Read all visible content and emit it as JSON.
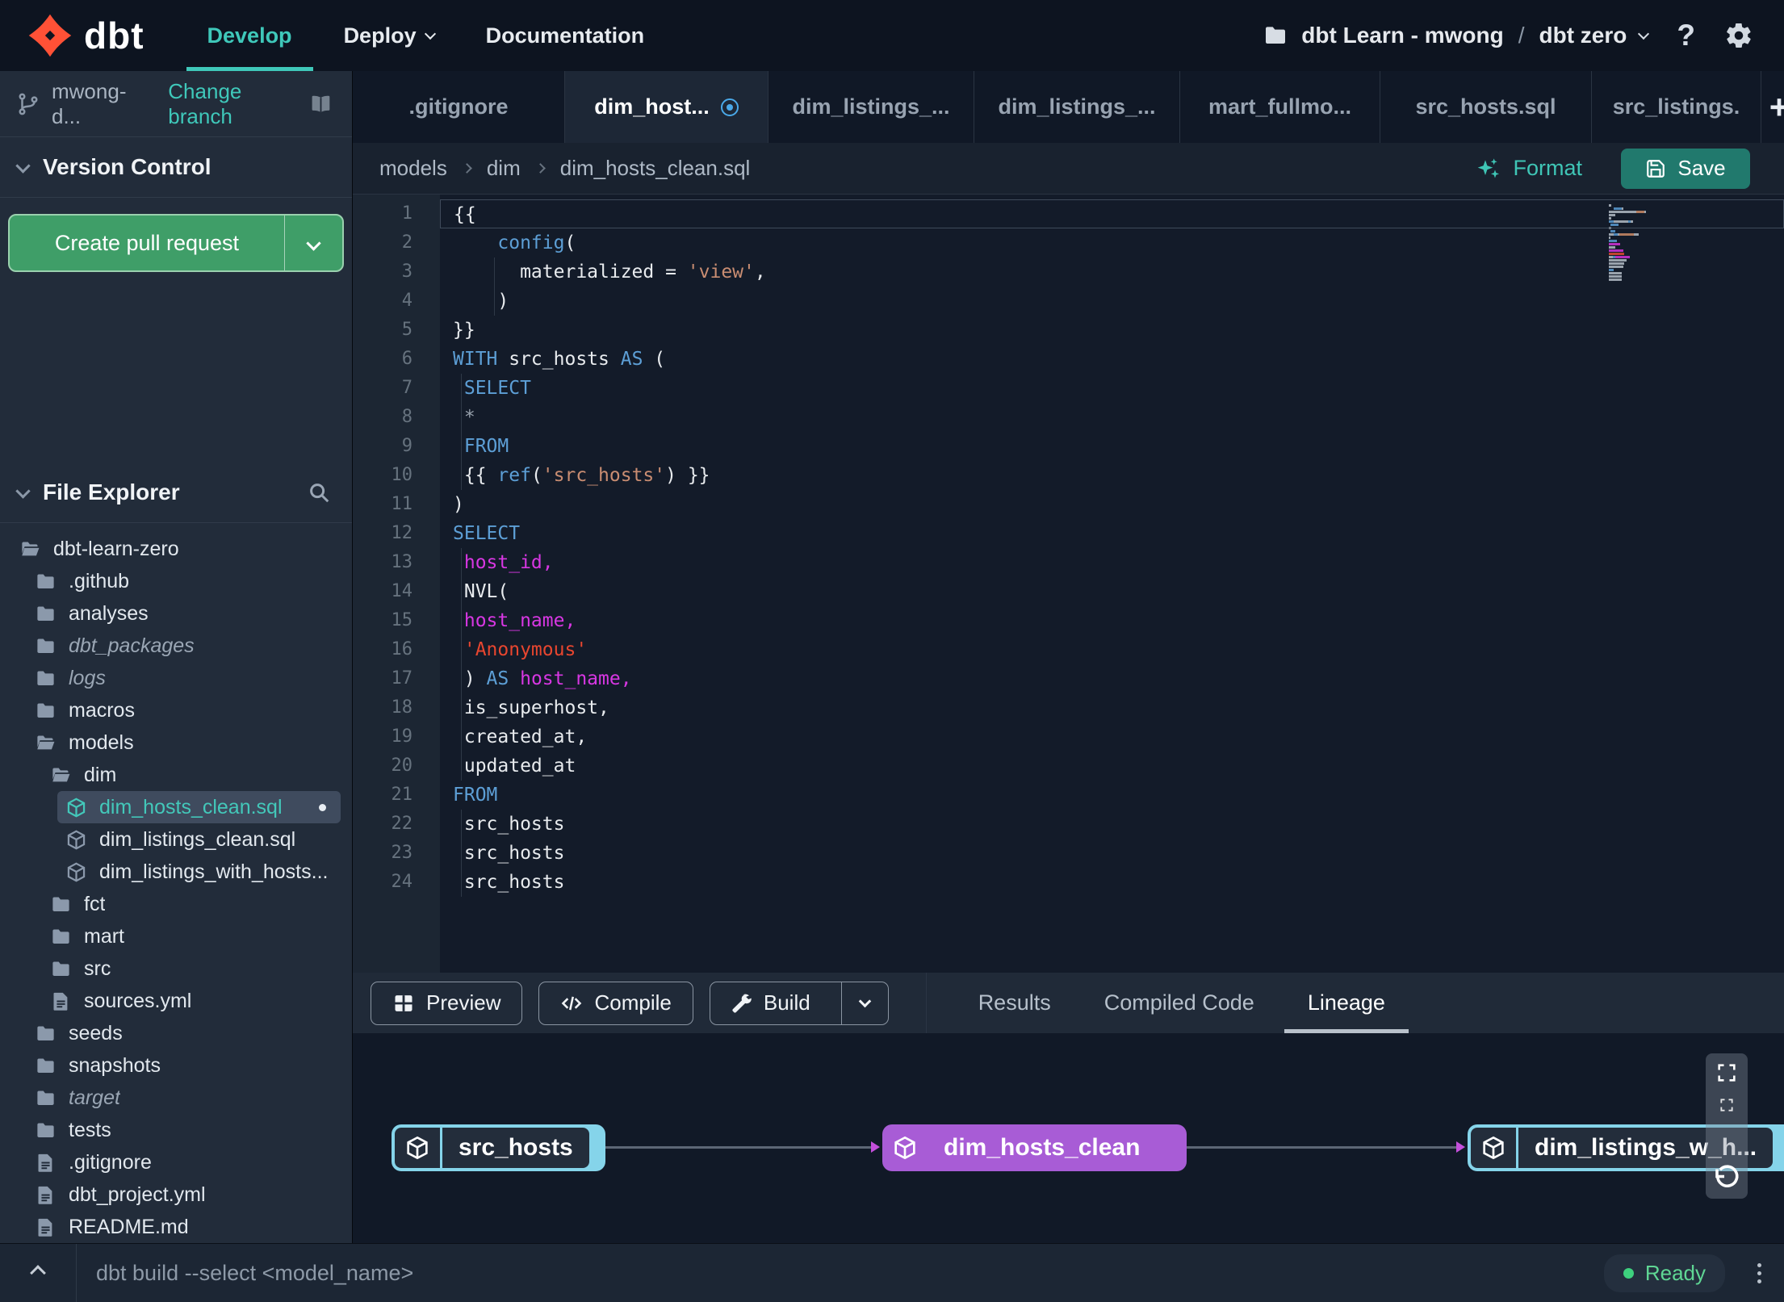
{
  "colors": {
    "accent_teal": "#3fc8ba",
    "brand_orange": "#ff5136",
    "pr_button_green": "#3f9e68",
    "save_button_teal": "#21796d",
    "tab_modified_blue": "#4aa9e9",
    "lineage_purple": "#a85cd6",
    "lineage_cyan": "#85d4ea",
    "status_ready_green": "#3ed17e",
    "syntax_keyword": "#5d9fd6",
    "syntax_jinja_string": "#c98d72",
    "syntax_sql_string": "#e8462f",
    "syntax_identifier": "#d837e3"
  },
  "topnav": {
    "logo_text": "dbt",
    "items": [
      {
        "label": "Develop",
        "active": true,
        "caret": false
      },
      {
        "label": "Deploy",
        "active": false,
        "caret": true
      },
      {
        "label": "Documentation",
        "active": false,
        "caret": false
      }
    ],
    "project": {
      "account": "dbt Learn - mwong",
      "separator": "/",
      "environment": "dbt zero"
    },
    "help_label": "?"
  },
  "sidebar": {
    "branch": {
      "name": "mwong-d...",
      "action": "Change branch"
    },
    "version_control_label": "Version Control",
    "create_pr_label": "Create pull request",
    "file_explorer_label": "File Explorer",
    "tree": [
      {
        "name": "dbt-learn-zero",
        "type": "folder-open",
        "indent": 0
      },
      {
        "name": ".github",
        "type": "folder",
        "indent": 1
      },
      {
        "name": "analyses",
        "type": "folder",
        "indent": 1
      },
      {
        "name": "dbt_packages",
        "type": "folder",
        "indent": 1,
        "italic": true
      },
      {
        "name": "logs",
        "type": "folder",
        "indent": 1,
        "italic": true
      },
      {
        "name": "macros",
        "type": "folder",
        "indent": 1
      },
      {
        "name": "models",
        "type": "folder-open",
        "indent": 1
      },
      {
        "name": "dim",
        "type": "folder-open",
        "indent": 2
      },
      {
        "name": "dim_hosts_clean.sql",
        "type": "model",
        "indent": 3,
        "selected": true,
        "modified": true
      },
      {
        "name": "dim_listings_clean.sql",
        "type": "model",
        "indent": 3
      },
      {
        "name": "dim_listings_with_hosts...",
        "type": "model",
        "indent": 3
      },
      {
        "name": "fct",
        "type": "folder",
        "indent": 2
      },
      {
        "name": "mart",
        "type": "folder",
        "indent": 2
      },
      {
        "name": "src",
        "type": "folder",
        "indent": 2
      },
      {
        "name": "sources.yml",
        "type": "file",
        "indent": 2
      },
      {
        "name": "seeds",
        "type": "folder",
        "indent": 1
      },
      {
        "name": "snapshots",
        "type": "folder",
        "indent": 1
      },
      {
        "name": "target",
        "type": "folder",
        "indent": 1,
        "italic": true
      },
      {
        "name": "tests",
        "type": "folder",
        "indent": 1
      },
      {
        "name": ".gitignore",
        "type": "file",
        "indent": 1
      },
      {
        "name": "dbt_project.yml",
        "type": "file",
        "indent": 1
      },
      {
        "name": "README.md",
        "type": "file",
        "indent": 1
      }
    ]
  },
  "tabs": [
    {
      "label": ".gitignore"
    },
    {
      "label": "dim_host...",
      "active": true,
      "modified": true
    },
    {
      "label": "dim_listings_..."
    },
    {
      "label": "dim_listings_..."
    },
    {
      "label": "mart_fullmo..."
    },
    {
      "label": "src_hosts.sql"
    },
    {
      "label": "src_listings."
    }
  ],
  "new_tab_label": "+",
  "editor_header": {
    "breadcrumbs": [
      "models",
      "dim",
      "dim_hosts_clean.sql"
    ],
    "format_label": "Format",
    "save_label": "Save"
  },
  "editor": {
    "lines": [
      {
        "cur": true,
        "s": [
          [
            "p",
            "{{"
          ]
        ]
      },
      {
        "s": [
          [
            "p",
            "    "
          ],
          [
            "kw",
            "config"
          ],
          [
            "p",
            "("
          ]
        ]
      },
      {
        "g": [
          4
        ],
        "s": [
          [
            "p",
            "      materialized = "
          ],
          [
            "sj",
            "'view'"
          ],
          [
            "p",
            ","
          ]
        ]
      },
      {
        "g": [
          4
        ],
        "s": [
          [
            "p",
            "    )"
          ]
        ]
      },
      {
        "s": [
          [
            "p",
            "}}"
          ]
        ]
      },
      {
        "s": [
          [
            "kw",
            "WITH"
          ],
          [
            "p",
            " src_hosts "
          ],
          [
            "kw",
            "AS"
          ],
          [
            "p",
            " ("
          ]
        ]
      },
      {
        "g": [
          1
        ],
        "s": [
          [
            "p",
            " "
          ],
          [
            "kw",
            "SELECT"
          ]
        ]
      },
      {
        "g": [
          1
        ],
        "s": [
          [
            "mut",
            " *"
          ]
        ]
      },
      {
        "g": [
          1
        ],
        "s": [
          [
            "p",
            " "
          ],
          [
            "kw",
            "FROM"
          ]
        ]
      },
      {
        "g": [
          1
        ],
        "s": [
          [
            "p",
            " {{ "
          ],
          [
            "kw",
            "ref"
          ],
          [
            "p",
            "("
          ],
          [
            "sj",
            "'src_hosts'"
          ],
          [
            "p",
            ") }}"
          ]
        ]
      },
      {
        "s": [
          [
            "p",
            ")"
          ]
        ]
      },
      {
        "s": [
          [
            "kw",
            "SELECT"
          ]
        ]
      },
      {
        "g": [
          1
        ],
        "s": [
          [
            "id",
            " host_id,"
          ]
        ]
      },
      {
        "g": [
          1
        ],
        "s": [
          [
            "p",
            " NVL("
          ]
        ]
      },
      {
        "g": [
          1
        ],
        "s": [
          [
            "id",
            " host_name,"
          ]
        ]
      },
      {
        "g": [
          1
        ],
        "s": [
          [
            "ss",
            " 'Anonymous'"
          ]
        ]
      },
      {
        "g": [
          1
        ],
        "s": [
          [
            "p",
            " ) "
          ],
          [
            "kw",
            "AS"
          ],
          [
            "id",
            " host_name,"
          ]
        ]
      },
      {
        "g": [
          1
        ],
        "s": [
          [
            "p",
            " is_superhost,"
          ]
        ]
      },
      {
        "g": [
          1
        ],
        "s": [
          [
            "p",
            " created_at,"
          ]
        ]
      },
      {
        "g": [
          1
        ],
        "s": [
          [
            "p",
            " updated_at"
          ]
        ]
      },
      {
        "s": [
          [
            "kw",
            "FROM"
          ]
        ]
      },
      {
        "g": [
          1
        ],
        "s": [
          [
            "p",
            " src_hosts"
          ]
        ]
      },
      {
        "g": [
          1
        ],
        "s": [
          [
            "p",
            " src_hosts"
          ]
        ]
      },
      {
        "g": [
          1
        ],
        "s": [
          [
            "p",
            " src_hosts"
          ]
        ]
      }
    ]
  },
  "bottom_toolbar": {
    "preview_label": "Preview",
    "compile_label": "Compile",
    "build_label": "Build",
    "tabs": [
      {
        "label": "Results"
      },
      {
        "label": "Compiled Code"
      },
      {
        "label": "Lineage",
        "active": true
      }
    ]
  },
  "lineage": {
    "nodes": [
      {
        "label": "src_hosts",
        "style": "cyan"
      },
      {
        "label": "dim_hosts_clean",
        "style": "purple"
      },
      {
        "label": "dim_listings_w_h...",
        "style": "cyan"
      }
    ]
  },
  "statusbar": {
    "command": "dbt build --select <model_name>",
    "status": "Ready"
  }
}
